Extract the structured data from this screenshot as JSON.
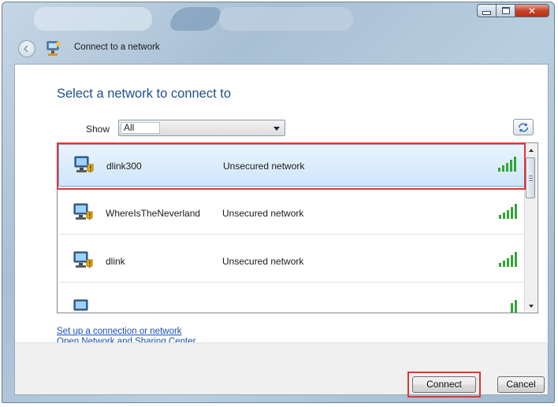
{
  "window": {
    "title": "Connect to a network",
    "caption_buttons": [
      "minimize",
      "maximize",
      "close"
    ],
    "close_glyph": "✕"
  },
  "main": {
    "heading": "Select a network to connect to",
    "show_label": "Show",
    "show_value": "All",
    "networks": [
      {
        "name": "dlink300",
        "status": "Unsecured network",
        "selected": true,
        "icon": "unsecured-network-icon",
        "signal": "5-bars"
      },
      {
        "name": "WhereIsTheNeverland",
        "status": "Unsecured network",
        "selected": false,
        "icon": "unsecured-network-icon",
        "signal": "5-bars"
      },
      {
        "name": "dlink",
        "status": "Unsecured network",
        "selected": false,
        "icon": "unsecured-network-icon",
        "signal": "5-bars"
      }
    ]
  },
  "links": {
    "setup": "Set up a connection or network",
    "sharing_center": "Open Network and Sharing Center"
  },
  "buttons": {
    "connect": "Connect",
    "cancel": "Cancel"
  },
  "colors": {
    "highlight": "#e03535",
    "heading": "#1f4f8a",
    "link": "#1a4fb8",
    "selected_row": "#cfe6fb"
  }
}
